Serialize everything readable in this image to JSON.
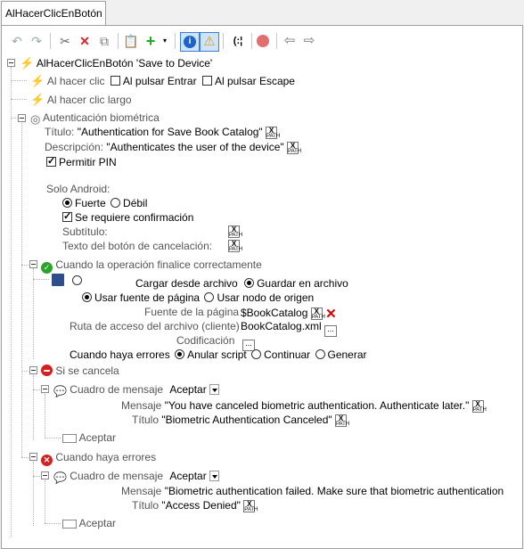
{
  "tab": {
    "title": "AlHacerClicEnBotón"
  },
  "toolbar": {
    "icons": [
      "undo-icon",
      "redo-icon",
      "cut-icon",
      "delete-icon",
      "copy-icon",
      "paste-icon",
      "add-icon",
      "info-icon",
      "warning-icon",
      "breakpoint-icon",
      "record-icon",
      "back-icon",
      "forward-icon"
    ],
    "breakpoint_text": "(:¦"
  },
  "tree": {
    "root": "AlHacerClicEnBotón 'Save to Device'",
    "on_click": "Al hacer clic",
    "on_enter": "Al pulsar Entrar",
    "on_escape": "Al pulsar Escape",
    "on_long_click": "Al hacer clic largo",
    "bio": {
      "title": "Autenticación biométrica",
      "titulo_label": "Título:",
      "titulo_value": "\"Authentication for Save Book Catalog\"",
      "desc_label": "Descripción:",
      "desc_value": "\"Authenticates the user of the device\"",
      "pin": "Permitir PIN",
      "android": "Solo Android:",
      "strong": "Fuerte",
      "weak": "Débil",
      "confirm": "Se requiere confirmación",
      "subtitle": "Subtítulo:",
      "cancel_text": "Texto del botón de cancelación:"
    },
    "success": {
      "title": "Cuando la operación finalice correctamente",
      "load": "Cargar desde archivo",
      "save": "Guardar en archivo",
      "page_source": "Usar fuente de página",
      "origin_node": "Usar nodo de origen",
      "page_source_label": "Fuente de la página",
      "page_source_value": "$BookCatalog",
      "path_label": "Ruta de acceso del archivo (cliente)",
      "path_value": "BookCatalog.xml",
      "encoding_label": "Codificación",
      "errors_label": "Cuando haya errores",
      "abort": "Anular script",
      "continue": "Continuar",
      "throw": "Generar"
    },
    "cancel": {
      "title": "Si se cancela",
      "msgbox": "Cuadro de mensaje",
      "button": "Aceptar",
      "message_label": "Mensaje",
      "message_value": "\"You have canceled biometric authentication. Authenticate later.\"",
      "title_label": "Título",
      "title_value": "\"Biometric Authentication Canceled\"",
      "accept": "Aceptar"
    },
    "error": {
      "title": "Cuando haya errores",
      "msgbox": "Cuadro de mensaje",
      "button": "Aceptar",
      "message_label": "Mensaje",
      "message_value": "\"Biometric authentication failed. Make sure that biometric authentication",
      "title_label": "Título",
      "title_value": "\"Access Denied\"",
      "accept": "Aceptar"
    }
  },
  "xpath_label": "X",
  "xpath_sub": "PATH",
  "ellipsis": "..."
}
